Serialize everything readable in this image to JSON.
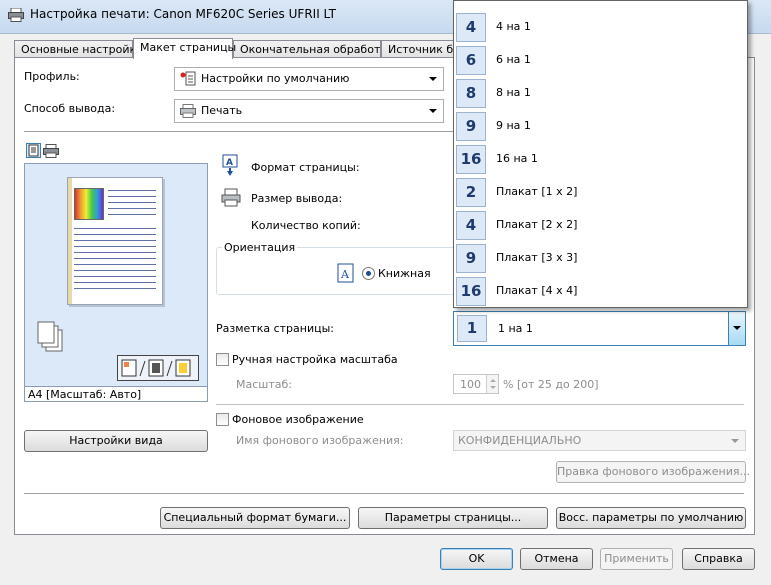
{
  "window": {
    "title": "Настройка печати: Canon MF620C Series UFRII LT"
  },
  "tabs": [
    {
      "label": "Основные настройки"
    },
    {
      "label": "Макет страницы"
    },
    {
      "label": "Окончательная обработка"
    },
    {
      "label": "Источник бум"
    }
  ],
  "profile": {
    "label": "Профиль:",
    "value": "Настройки по умолчанию"
  },
  "output": {
    "label": "Способ вывода:",
    "value": "Печать"
  },
  "preview": {
    "caption": "A4 [Масштаб: Авто]",
    "settings_button": "Настройки вида"
  },
  "page_format": {
    "label": "Формат страницы:"
  },
  "output_size": {
    "label": "Размер вывода:"
  },
  "copies": {
    "label": "Количество копий:"
  },
  "orientation": {
    "group_label": "Ориентация",
    "portrait": "Книжная"
  },
  "layout": {
    "label": "Разметка страницы:",
    "selected": {
      "icon": "1",
      "label": "1 на 1"
    },
    "options": [
      {
        "icon": "4",
        "label": "4 на 1"
      },
      {
        "icon": "6",
        "label": "6 на 1"
      },
      {
        "icon": "8",
        "label": "8 на 1"
      },
      {
        "icon": "9",
        "label": "9 на 1"
      },
      {
        "icon": "16",
        "label": "16 на 1"
      },
      {
        "icon": "2",
        "label": "Плакат [1 x 2]"
      },
      {
        "icon": "4",
        "label": "Плакат [2 x 2]"
      },
      {
        "icon": "9",
        "label": "Плакат [3 x 3]"
      },
      {
        "icon": "16",
        "label": "Плакат [4 x 4]"
      }
    ]
  },
  "manual_scale": {
    "label": "Ручная настройка масштаба",
    "scale_label": "Масштаб:",
    "value": "100",
    "range": "% [от 25 до 200]"
  },
  "watermark": {
    "label": "Фоновое изображение",
    "name_label": "Имя фонового изображения:",
    "value": "КОНФИДЕНЦИАЛЬНО",
    "edit_button": "Правка фонового изображения..."
  },
  "bottom_buttons": {
    "custom_paper": "Специальный формат бумаги...",
    "page_options": "Параметры страницы...",
    "restore_defaults": "Восс. параметры по умолчанию"
  },
  "dialog_buttons": {
    "ok": "OK",
    "cancel": "Отмена",
    "apply": "Применить",
    "help": "Справка"
  }
}
